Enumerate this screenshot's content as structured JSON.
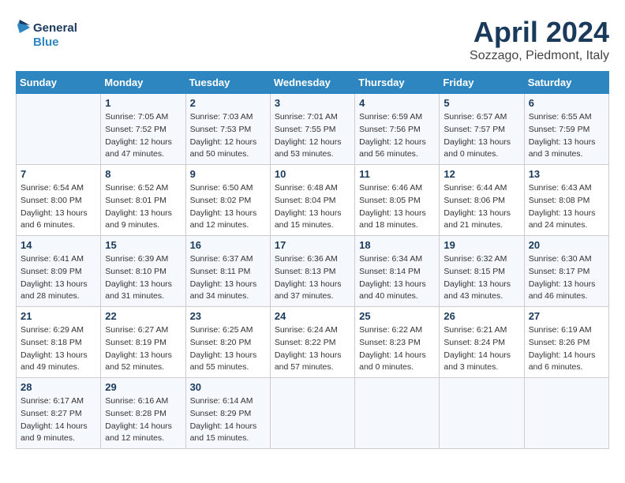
{
  "header": {
    "logo_line1": "General",
    "logo_line2": "Blue",
    "month": "April 2024",
    "location": "Sozzago, Piedmont, Italy"
  },
  "days_of_week": [
    "Sunday",
    "Monday",
    "Tuesday",
    "Wednesday",
    "Thursday",
    "Friday",
    "Saturday"
  ],
  "weeks": [
    [
      {
        "day": "",
        "info": ""
      },
      {
        "day": "1",
        "info": "Sunrise: 7:05 AM\nSunset: 7:52 PM\nDaylight: 12 hours\nand 47 minutes."
      },
      {
        "day": "2",
        "info": "Sunrise: 7:03 AM\nSunset: 7:53 PM\nDaylight: 12 hours\nand 50 minutes."
      },
      {
        "day": "3",
        "info": "Sunrise: 7:01 AM\nSunset: 7:55 PM\nDaylight: 12 hours\nand 53 minutes."
      },
      {
        "day": "4",
        "info": "Sunrise: 6:59 AM\nSunset: 7:56 PM\nDaylight: 12 hours\nand 56 minutes."
      },
      {
        "day": "5",
        "info": "Sunrise: 6:57 AM\nSunset: 7:57 PM\nDaylight: 13 hours\nand 0 minutes."
      },
      {
        "day": "6",
        "info": "Sunrise: 6:55 AM\nSunset: 7:59 PM\nDaylight: 13 hours\nand 3 minutes."
      }
    ],
    [
      {
        "day": "7",
        "info": "Sunrise: 6:54 AM\nSunset: 8:00 PM\nDaylight: 13 hours\nand 6 minutes."
      },
      {
        "day": "8",
        "info": "Sunrise: 6:52 AM\nSunset: 8:01 PM\nDaylight: 13 hours\nand 9 minutes."
      },
      {
        "day": "9",
        "info": "Sunrise: 6:50 AM\nSunset: 8:02 PM\nDaylight: 13 hours\nand 12 minutes."
      },
      {
        "day": "10",
        "info": "Sunrise: 6:48 AM\nSunset: 8:04 PM\nDaylight: 13 hours\nand 15 minutes."
      },
      {
        "day": "11",
        "info": "Sunrise: 6:46 AM\nSunset: 8:05 PM\nDaylight: 13 hours\nand 18 minutes."
      },
      {
        "day": "12",
        "info": "Sunrise: 6:44 AM\nSunset: 8:06 PM\nDaylight: 13 hours\nand 21 minutes."
      },
      {
        "day": "13",
        "info": "Sunrise: 6:43 AM\nSunset: 8:08 PM\nDaylight: 13 hours\nand 24 minutes."
      }
    ],
    [
      {
        "day": "14",
        "info": "Sunrise: 6:41 AM\nSunset: 8:09 PM\nDaylight: 13 hours\nand 28 minutes."
      },
      {
        "day": "15",
        "info": "Sunrise: 6:39 AM\nSunset: 8:10 PM\nDaylight: 13 hours\nand 31 minutes."
      },
      {
        "day": "16",
        "info": "Sunrise: 6:37 AM\nSunset: 8:11 PM\nDaylight: 13 hours\nand 34 minutes."
      },
      {
        "day": "17",
        "info": "Sunrise: 6:36 AM\nSunset: 8:13 PM\nDaylight: 13 hours\nand 37 minutes."
      },
      {
        "day": "18",
        "info": "Sunrise: 6:34 AM\nSunset: 8:14 PM\nDaylight: 13 hours\nand 40 minutes."
      },
      {
        "day": "19",
        "info": "Sunrise: 6:32 AM\nSunset: 8:15 PM\nDaylight: 13 hours\nand 43 minutes."
      },
      {
        "day": "20",
        "info": "Sunrise: 6:30 AM\nSunset: 8:17 PM\nDaylight: 13 hours\nand 46 minutes."
      }
    ],
    [
      {
        "day": "21",
        "info": "Sunrise: 6:29 AM\nSunset: 8:18 PM\nDaylight: 13 hours\nand 49 minutes."
      },
      {
        "day": "22",
        "info": "Sunrise: 6:27 AM\nSunset: 8:19 PM\nDaylight: 13 hours\nand 52 minutes."
      },
      {
        "day": "23",
        "info": "Sunrise: 6:25 AM\nSunset: 8:20 PM\nDaylight: 13 hours\nand 55 minutes."
      },
      {
        "day": "24",
        "info": "Sunrise: 6:24 AM\nSunset: 8:22 PM\nDaylight: 13 hours\nand 57 minutes."
      },
      {
        "day": "25",
        "info": "Sunrise: 6:22 AM\nSunset: 8:23 PM\nDaylight: 14 hours\nand 0 minutes."
      },
      {
        "day": "26",
        "info": "Sunrise: 6:21 AM\nSunset: 8:24 PM\nDaylight: 14 hours\nand 3 minutes."
      },
      {
        "day": "27",
        "info": "Sunrise: 6:19 AM\nSunset: 8:26 PM\nDaylight: 14 hours\nand 6 minutes."
      }
    ],
    [
      {
        "day": "28",
        "info": "Sunrise: 6:17 AM\nSunset: 8:27 PM\nDaylight: 14 hours\nand 9 minutes."
      },
      {
        "day": "29",
        "info": "Sunrise: 6:16 AM\nSunset: 8:28 PM\nDaylight: 14 hours\nand 12 minutes."
      },
      {
        "day": "30",
        "info": "Sunrise: 6:14 AM\nSunset: 8:29 PM\nDaylight: 14 hours\nand 15 minutes."
      },
      {
        "day": "",
        "info": ""
      },
      {
        "day": "",
        "info": ""
      },
      {
        "day": "",
        "info": ""
      },
      {
        "day": "",
        "info": ""
      }
    ]
  ]
}
